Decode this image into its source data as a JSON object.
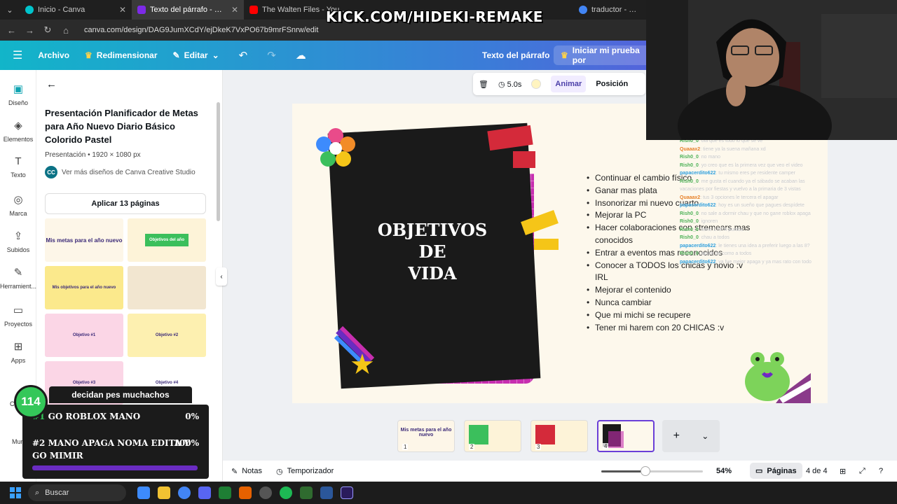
{
  "browser": {
    "tabs": [
      {
        "label": "Inicio - Canva",
        "color": "#00c4cc"
      },
      {
        "label": "Texto del párrafo - Presentación",
        "color": "#7d2ae8"
      },
      {
        "label": "The Walten Files - YouTube",
        "color": "#ff0000"
      },
      {
        "label": "traductor - Buscar con",
        "color": "#4285f4"
      }
    ],
    "url": "canva.com/design/DAG9JumXCdY/ejDkeK7VxPO67b9mrFSnrw/edit"
  },
  "overlay": {
    "kick_banner": "KICK.COM/HIDEKI-REMAKE"
  },
  "topbar": {
    "file_label": "Archivo",
    "resize_label": "Redimensionar",
    "edit_label": "Editar",
    "element_label": "Texto del párrafo",
    "trial_label": "Iniciar mi prueba por"
  },
  "rail": {
    "items": [
      {
        "label": "Diseño",
        "icon": "design-icon"
      },
      {
        "label": "Elementos",
        "icon": "elements-icon"
      },
      {
        "label": "Texto",
        "icon": "text-icon"
      },
      {
        "label": "Marca",
        "icon": "brand-icon"
      },
      {
        "label": "Subidos",
        "icon": "upload-icon"
      },
      {
        "label": "Herramient...",
        "icon": "tools-icon"
      },
      {
        "label": "Proyectos",
        "icon": "folder-icon"
      },
      {
        "label": "Apps",
        "icon": "apps-icon"
      },
      {
        "label": "Conte",
        "icon": "content-icon"
      },
      {
        "label": "Murf",
        "icon": "murf-icon"
      }
    ]
  },
  "panel": {
    "title": "Presentación Planificador de Metas para Año Nuevo Diario Básico Colorido Pastel",
    "meta": "Presentación • 1920 × 1080 px",
    "more_designs": "Ver más diseños de Canva Creative Studio",
    "creator_initials": "CC",
    "apply_button": "Aplicar 13 páginas",
    "thumbs": [
      {
        "label": "Mis metas para el año nuevo"
      },
      {
        "label": "Objetivos del año"
      },
      {
        "label": "Mis objetivos para el año nuevo"
      },
      {
        "label": ""
      },
      {
        "label": "Objetivo #1"
      },
      {
        "label": "Objetivo #2"
      },
      {
        "label": "Objetivo #3"
      },
      {
        "label": "Objetivo #4"
      }
    ]
  },
  "canvas_toolbar": {
    "duration": "5.0s",
    "animate": "Animar",
    "position": "Posición"
  },
  "slide": {
    "title_lines": [
      "OBJETIVOS",
      "DE",
      "VIDA"
    ],
    "goals": [
      "Continuar el cambio físico",
      "Ganar mas plata",
      "Insonorizar mi nuevo cuarto",
      "Mejorar la PC",
      "Hacer colaboraciones con stremears mas conocidos",
      "Entrar a eventos mas reconocidos",
      "Conocer a TODOS los chicas y novio :v IRL",
      "Mejorar el contenido",
      "Nunca cambiar",
      "Que mi michi se recupere",
      "Tener mi harem con 20 CHICAS :v"
    ]
  },
  "chat": [
    {
      "user": "Rish0_0",
      "msg": ": ola que es todo lo que se ve"
    },
    {
      "user": "Quaaax2",
      "msg": ": tiene ya la suena mañana xd"
    },
    {
      "user": "Rish0_0",
      "msg": ": no mano"
    },
    {
      "user": "Rish0_0",
      "msg": ": yo creo que es la primera vez que veo el video"
    },
    {
      "user": "papacerdito622",
      "msg": ": tu mismo eres pe residente camper"
    },
    {
      "user": "Rish0_0",
      "msg": ": me gusta el cuando ya el sábado se acaban las"
    },
    {
      "user": "",
      "msg": "vacaciones por fiestas y vuelvo a la primaria de 3 vistas"
    },
    {
      "user": "Quaaax2",
      "msg": ": tus 3 opciones le tercera el apagar"
    },
    {
      "user": "papacerdito622",
      "msg": ": hoy es un sueño que pagues despídete"
    },
    {
      "user": "Rish0_0",
      "msg": ": no sale a dormir chau y que no gane roblox apaga"
    },
    {
      "user": "Rish0_0",
      "msg": ": ignoren"
    },
    {
      "user": "Rish0_0",
      "msg": ": tiene 17974 puntos"
    },
    {
      "user": "Rish0_0",
      "msg": ": chau a todos"
    },
    {
      "user": "papacerdito622",
      "msg": ": le tienes una idea a preferir luego a las 8?"
    },
    {
      "user": "Rish0_0",
      "msg": ": apure pe como a todos"
    },
    {
      "user": "papacerdito622",
      "msg": ": ya fue mejor apaga y ya mas rato con todo"
    }
  ],
  "pages_strip": [
    {
      "num": "1",
      "label": "Mis metas para el año nuevo"
    },
    {
      "num": "2",
      "label": ""
    },
    {
      "num": "3",
      "label": ""
    },
    {
      "num": "4",
      "label": ""
    }
  ],
  "bottombar": {
    "notes": "Notas",
    "timer": "Temporizador",
    "zoom": "54%",
    "zoom_level": 0.54,
    "pages": "Páginas",
    "page_count": "4 de 4"
  },
  "poll": {
    "count": "114",
    "title": "decidan pes muchachos",
    "options": [
      {
        "num": "#1",
        "label": "GO ROBLOX MANO",
        "pct": "0%"
      },
      {
        "num": "#2",
        "label": "MANO APAGA NOMA EDITA Y GO MIMIR",
        "pct": "100%"
      }
    ]
  },
  "taskbar": {
    "search": "Buscar",
    "apps": [
      "#3d8bfd",
      "#f1c232",
      "#4285f4",
      "#5865f2",
      "#1e7e34",
      "#e66100",
      "#555555",
      "#1db954",
      "#2f6b2f",
      "#2b579a",
      "#9999ff"
    ]
  }
}
